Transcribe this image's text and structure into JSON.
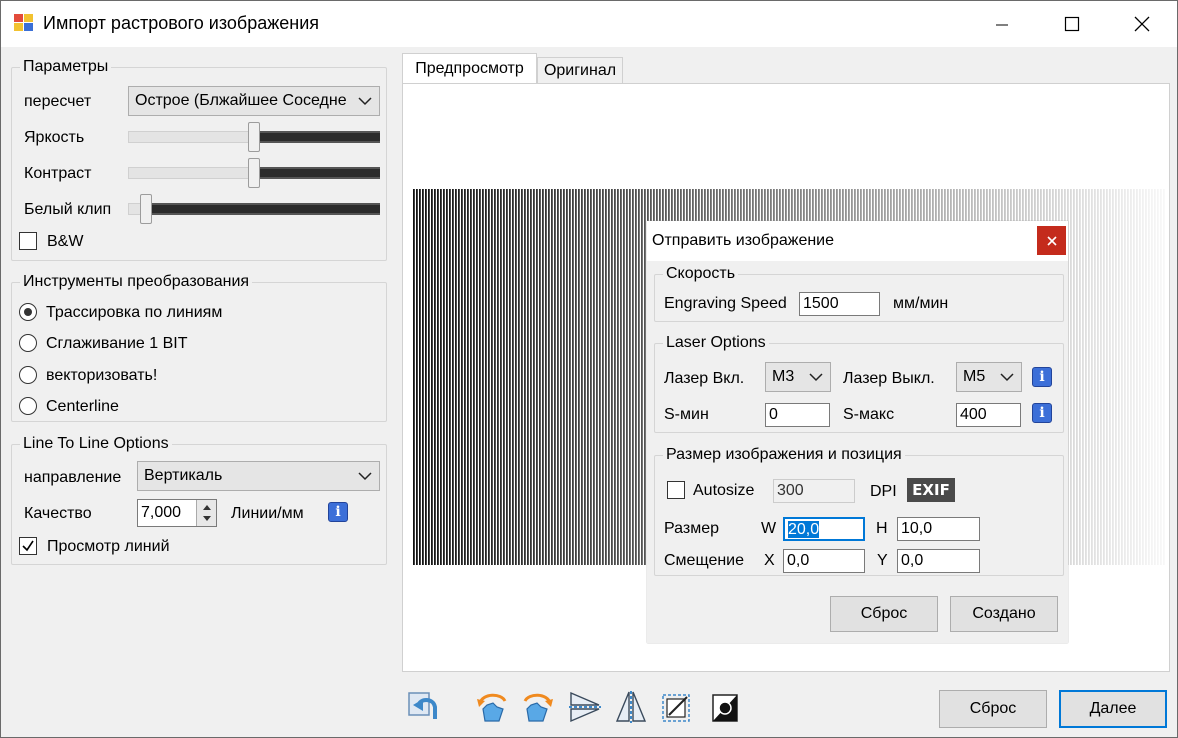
{
  "window": {
    "title": "Импорт растрового изображения"
  },
  "params": {
    "title": "Параметры",
    "resample_label": "пересчет",
    "resample_value": "Острое (Блжайшее Соседнее)",
    "brightness_label": "Яркость",
    "contrast_label": "Контраст",
    "whiteclip_label": "Белый клип",
    "bw_label": "B&W",
    "bw_checked": false,
    "brightness_level": 0.5,
    "contrast_level": 0.5,
    "whiteclip_level": 0.05
  },
  "tools": {
    "title": "Инструменты преобразования",
    "options": [
      "Трассировка по линиям",
      "Сглаживание 1 BIT",
      "векторизовать!",
      "Centerline"
    ],
    "selected_index": 0
  },
  "ltl": {
    "title": "Line To Line Options",
    "direction_label": "направление",
    "direction_value": "Вертикаль",
    "quality_label": "Качество",
    "quality_value": "7,000",
    "quality_unit": "Линии/мм",
    "preview_label": "Просмотр линий",
    "preview_checked": true
  },
  "tabs": [
    "Предпросмотр",
    "Оригинал"
  ],
  "active_tab": 0,
  "dialog": {
    "title": "Отправить изображение",
    "speed_group": "Скорость",
    "speed_label": "Engraving Speed",
    "speed_value": "1500",
    "speed_unit": "мм/мин",
    "laser_group": "Laser Options",
    "laser_on_label": "Лазер Вкл.",
    "laser_on_value": "M3",
    "laser_off_label": "Лазер Выкл.",
    "laser_off_value": "M5",
    "smin_label": "S-мин",
    "smin_value": "0",
    "smax_label": "S-макс",
    "smax_value": "400",
    "size_group": "Размер изображения и позиция",
    "autosize_label": "Autosize",
    "dpi_value": "300",
    "dpi_label": "DPI",
    "exif_label": "EXIF",
    "size_label": "Размер",
    "w_label": "W",
    "w_value": "20,0",
    "h_label": "H",
    "h_value": "10,0",
    "offset_label": "Смещение",
    "x_label": "X",
    "x_value": "0,0",
    "y_label": "Y",
    "y_value": "0,0",
    "reset_label": "Сброс",
    "create_label": "Создано"
  },
  "footer": {
    "reset_label": "Сброс",
    "next_label": "Далее",
    "icons": [
      "reset-image-icon",
      "rotate-ccw-icon",
      "rotate-cw-icon",
      "flip-horizontal-icon",
      "flip-vertical-icon",
      "crop-icon",
      "invert-icon"
    ]
  },
  "colors": {
    "accent": "#0078d7",
    "info": "#3c6fd8",
    "close": "#c42b1c"
  }
}
